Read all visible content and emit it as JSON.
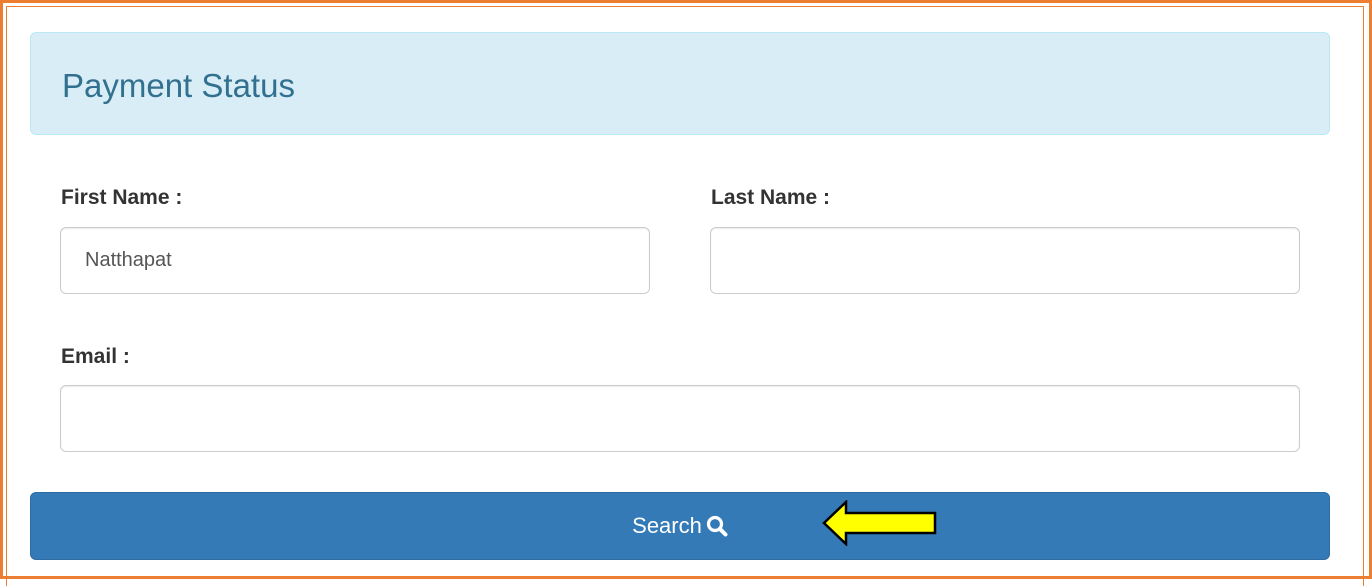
{
  "panel": {
    "title": "Payment Status"
  },
  "form": {
    "first_name": {
      "label": "First Name :",
      "value": "Natthapat",
      "placeholder": ""
    },
    "last_name": {
      "label": "Last Name :",
      "value": "",
      "placeholder": ""
    },
    "email": {
      "label": "Email :",
      "value": "",
      "placeholder": ""
    }
  },
  "search_button": {
    "label": "Search",
    "icon": "search-icon"
  },
  "annotation": {
    "icon": "arrow-left-icon",
    "color": "#ffff00"
  },
  "colors": {
    "frame_border": "#ed7d31",
    "heading_bg": "#d9edf7",
    "heading_text": "#31708f",
    "button_bg": "#337ab7"
  }
}
